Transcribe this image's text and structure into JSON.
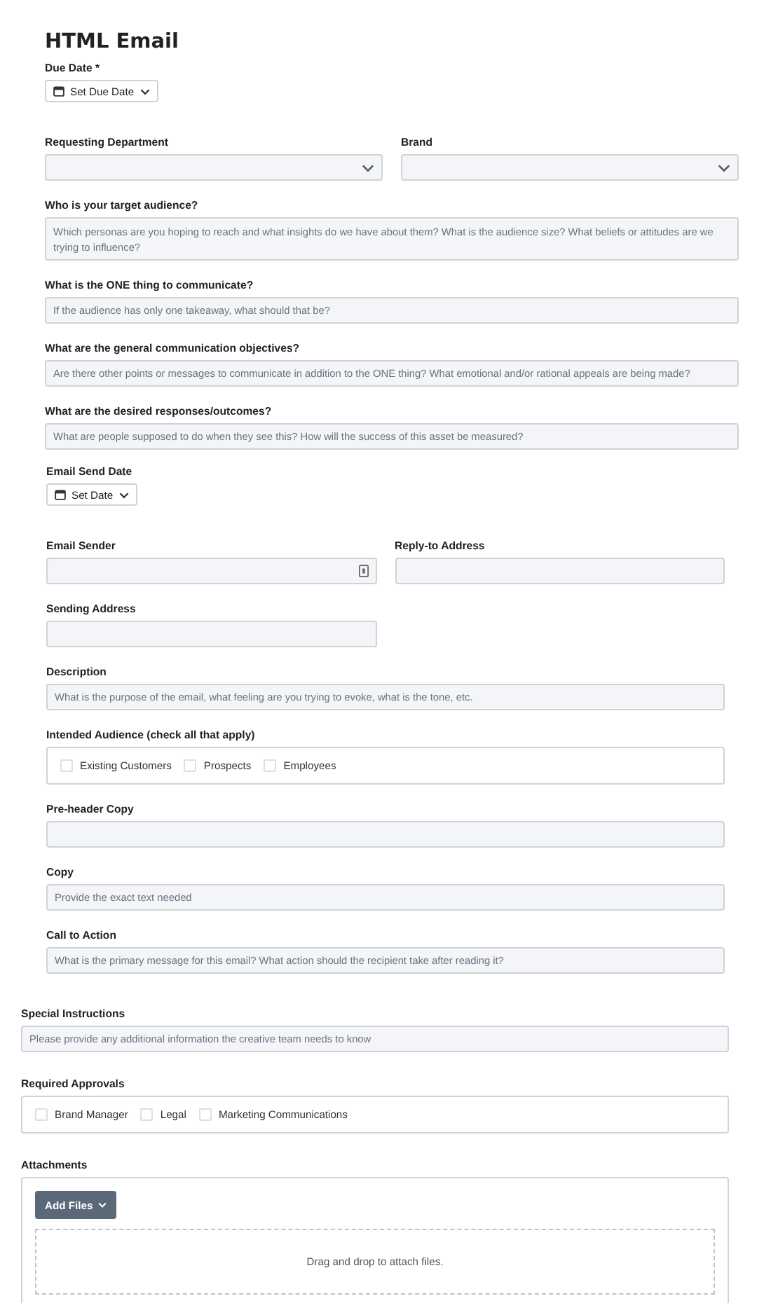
{
  "title": "HTML Email",
  "sections": [
    {
      "fields": [
        {
          "kind": "date",
          "label": "Due Date *",
          "button": "Set Due Date"
        },
        {
          "kind": "row",
          "fields": [
            {
              "kind": "select",
              "label": "Requesting Department"
            },
            {
              "kind": "select",
              "label": "Brand"
            }
          ]
        },
        {
          "kind": "textarea",
          "label": "Who is your target audience?",
          "placeholder": "Which personas are you hoping to reach and what insights do we have about them? What is the audience size? What beliefs or attitudes are we trying to influence?"
        },
        {
          "kind": "text",
          "label": "What is the ONE thing to communicate?",
          "placeholder": "If the audience has only one takeaway, what should that be?"
        },
        {
          "kind": "text",
          "label": "What are the general communication objectives?",
          "placeholder": "Are there other points or messages to communicate in addition to the ONE thing? What emotional and/or rational appeals are being made?"
        },
        {
          "kind": "text",
          "label": "What are the desired responses/outcomes?",
          "placeholder": "What are people supposed to do when they see this? How will the success of this asset be measured?"
        }
      ]
    },
    {
      "fields": [
        {
          "kind": "date",
          "label": "Email Send Date",
          "button": "Set Date"
        },
        {
          "kind": "row",
          "fields": [
            {
              "kind": "text",
              "label": "Email Sender",
              "contact_icon": true
            },
            {
              "kind": "text",
              "label": "Reply-to Address"
            }
          ]
        },
        {
          "kind": "row",
          "fields": [
            {
              "kind": "text",
              "label": "Sending Address"
            },
            {
              "kind": "blank"
            }
          ]
        },
        {
          "kind": "text",
          "label": "Description",
          "placeholder": "What is the purpose of the email, what feeling are you trying to evoke, what is the tone, etc."
        },
        {
          "kind": "checks",
          "label": "Intended Audience (check all that apply)",
          "options": [
            {
              "label": "Existing Customers",
              "checked": false
            },
            {
              "label": "Prospects",
              "checked": false
            },
            {
              "label": "Employees",
              "checked": false
            }
          ]
        },
        {
          "kind": "text",
          "label": "Pre-header Copy"
        },
        {
          "kind": "text",
          "label": "Copy",
          "placeholder": "Provide the exact text needed"
        },
        {
          "kind": "text",
          "label": "Call to Action",
          "placeholder": "What is the primary message for this email? What action should the recipient take after reading it?"
        }
      ]
    },
    {
      "fields": [
        {
          "kind": "text",
          "label": "Special Instructions",
          "placeholder": "Please provide any additional information the creative team needs to know"
        },
        {
          "kind": "checks",
          "label": "Required Approvals",
          "options": [
            {
              "label": "Brand Manager",
              "checked": false
            },
            {
              "label": "Legal",
              "checked": false
            },
            {
              "label": "Marketing Communications",
              "checked": false
            }
          ]
        },
        {
          "kind": "upload",
          "label": "Attachments",
          "button": "Add Files",
          "drop_text": "Drag and drop to attach files."
        }
      ]
    }
  ]
}
